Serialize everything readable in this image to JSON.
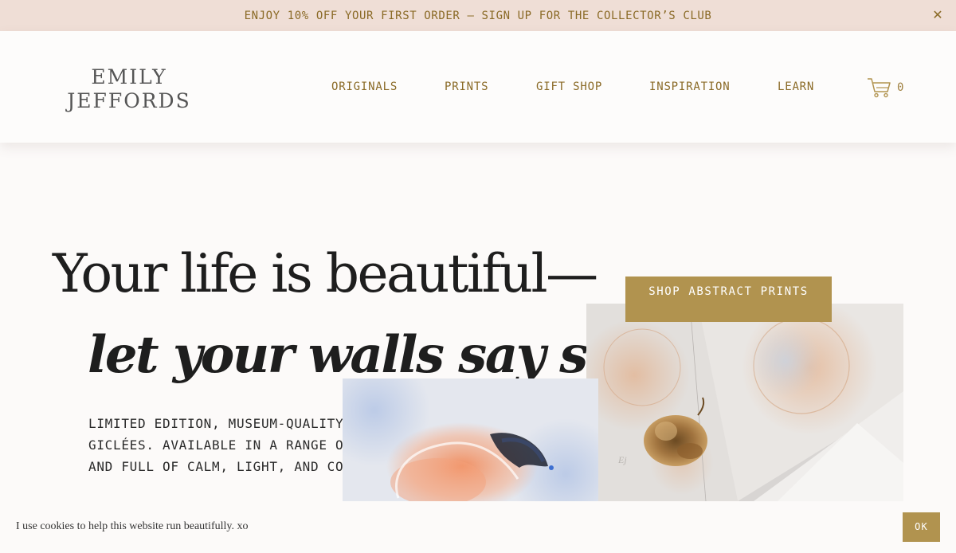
{
  "announcement": {
    "text": "ENJOY 10% OFF YOUR FIRST ORDER — SIGN UP FOR THE COLLECTOR’S CLUB",
    "close_label": "✕"
  },
  "header": {
    "logo_line1": "EMILY",
    "logo_line2": "JEFFORDS",
    "nav": [
      "ORIGINALS",
      "PRINTS",
      "GIFT SHOP",
      "INSPIRATION",
      "LEARN"
    ],
    "cart_icon": "cart-icon",
    "cart_count": "0"
  },
  "hero": {
    "line1": "Your life is beautiful—",
    "line2": "let your walls say so, too",
    "subtext": "LIMITED EDITION, MUSEUM-QUALITY GICLÉES. AVAILABLE IN A RANGE OF SIZES AND FULL OF CALM, LIGHT, AND COLOR.",
    "cta_label": "SHOP ABSTRACT PRINTS"
  },
  "cookie_bar": {
    "text": "I use cookies to help this website run beautifully. xo",
    "ok_label": "OK"
  },
  "colors": {
    "accent_gold": "#b1934f",
    "nav_text": "#8a6a26",
    "announcement_bg": "#efded6",
    "page_bg": "#fcfaf9"
  }
}
